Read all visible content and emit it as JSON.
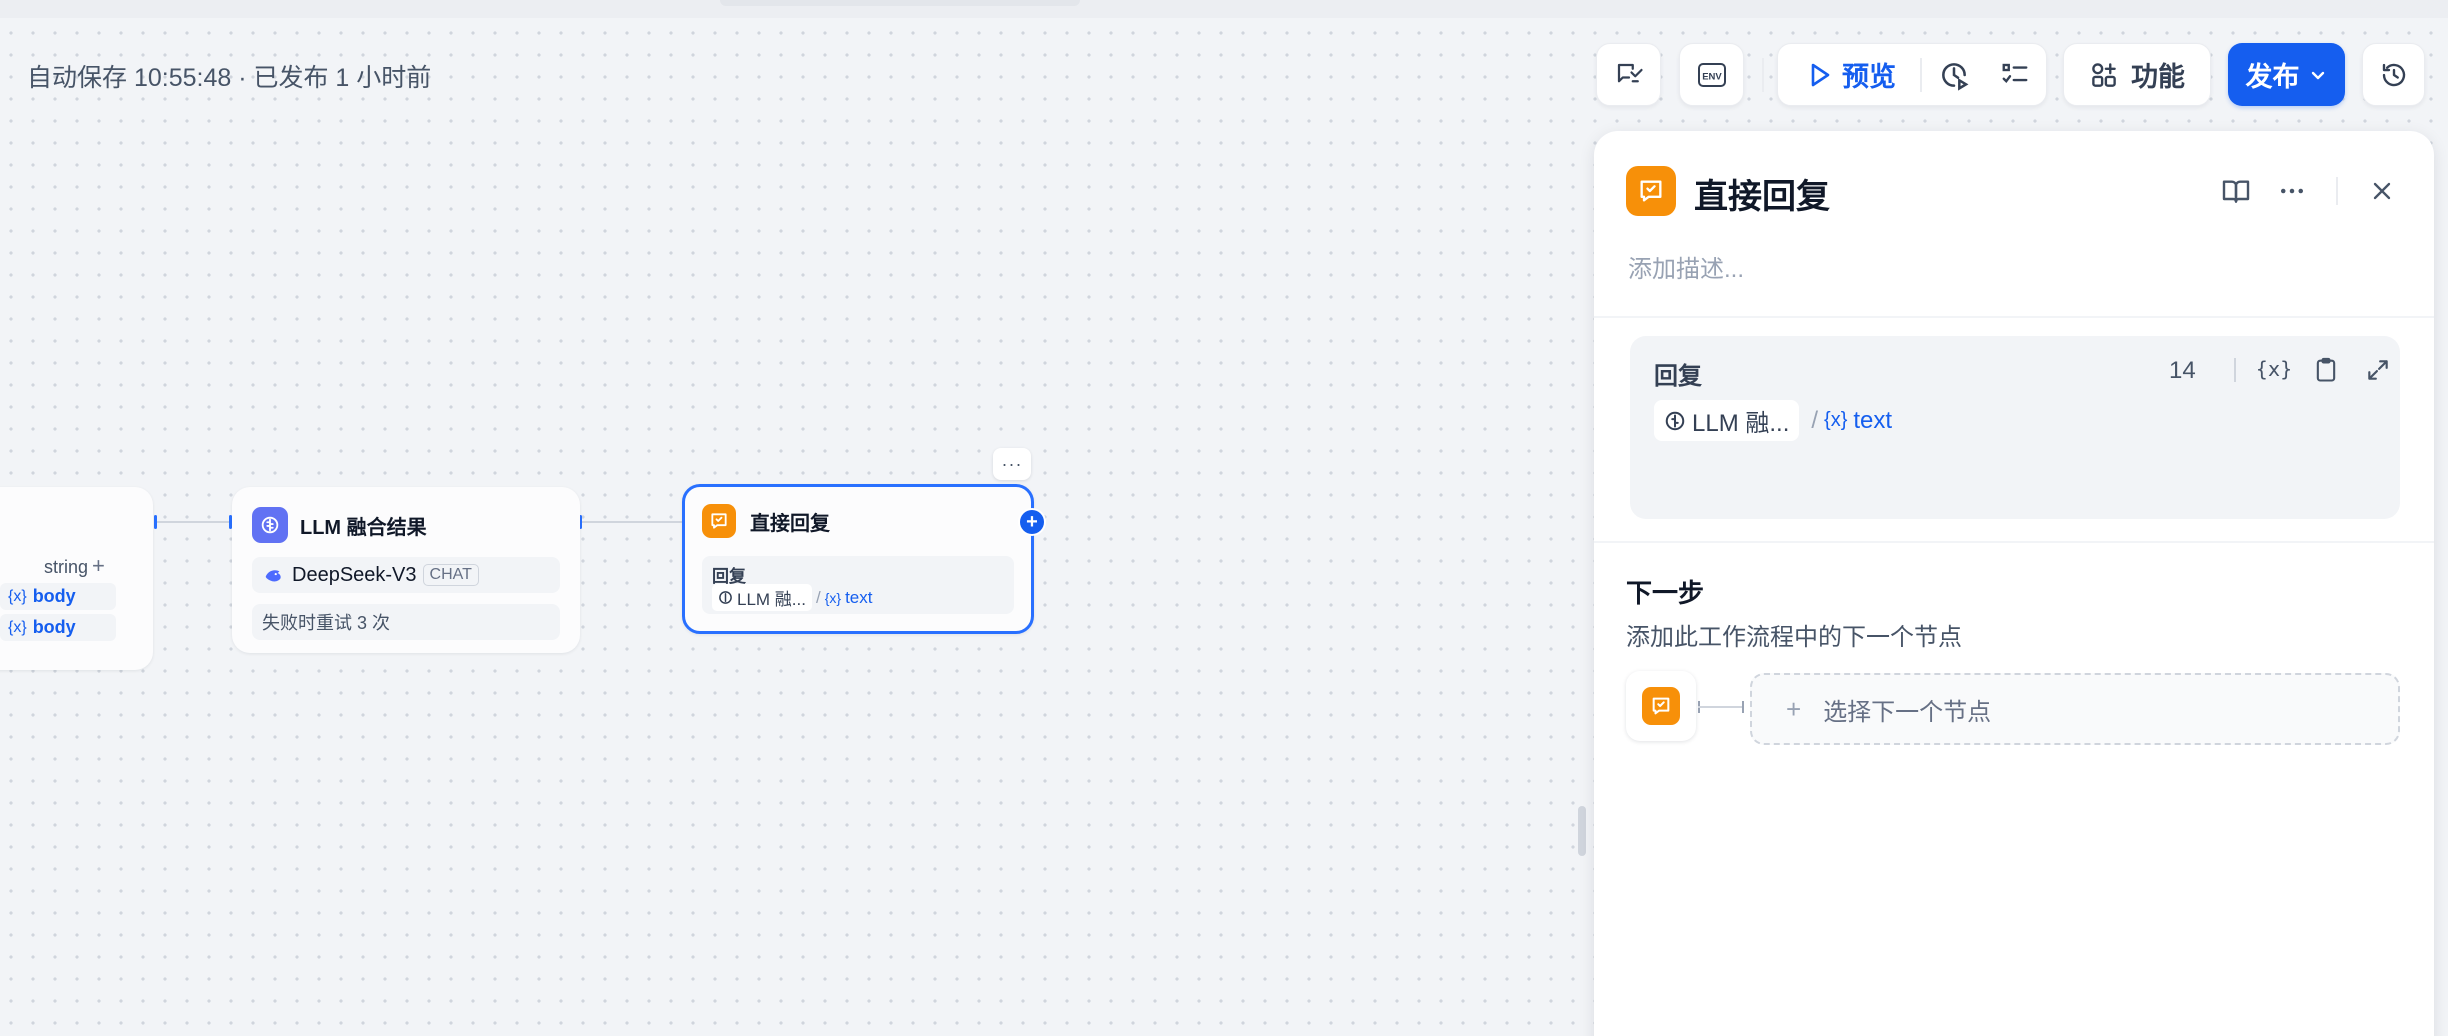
{
  "header": {
    "autosave_text": "自动保存 10:55:48 · 已发布 1 小时前"
  },
  "toolbar": {
    "preview_label": "预览",
    "features_label": "功能",
    "publish_label": "发布",
    "env_icon_text": "ENV"
  },
  "canvas": {
    "start_node": {
      "type_label": "string",
      "plus": "+",
      "vars": [
        {
          "label": "body"
        },
        {
          "label": "body"
        }
      ]
    },
    "llm_node": {
      "title": "LLM 融合结果",
      "model_name": "DeepSeek-V3",
      "model_mode": "CHAT",
      "retry_text": "失败时重试 3 次"
    },
    "answer_node": {
      "title": "直接回复",
      "field_label": "回复",
      "ref_node": "LLM 融...",
      "ref_var": "text",
      "more": "···",
      "plus": "+"
    }
  },
  "panel": {
    "title": "直接回复",
    "description_placeholder": "添加描述...",
    "reply": {
      "label": "回复",
      "count": "14",
      "ref_node": "LLM 融...",
      "ref_sep": "/",
      "ref_var": "text"
    },
    "next_step": {
      "title": "下一步",
      "subtitle": "添加此工作流程中的下一个节点",
      "select_label": "选择下一个节点",
      "plus": "+"
    }
  },
  "colors": {
    "accent": "#155eef",
    "answer_icon": "#f79009",
    "llm_icon": "#6172f3"
  },
  "icons": {
    "answer": "reply-chat-icon",
    "llm": "llm-brain-icon",
    "deepseek": "deepseek-whale-icon"
  }
}
